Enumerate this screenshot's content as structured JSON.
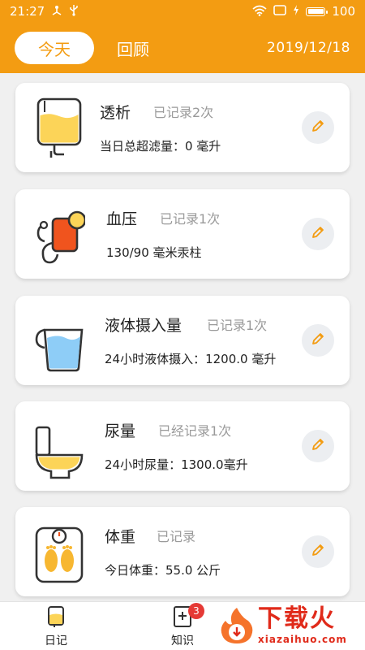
{
  "status_bar": {
    "time": "21:27",
    "battery": "100",
    "icons": [
      "usb-share-icon",
      "usb-icon",
      "wifi-icon",
      "sim-icon",
      "charging-icon",
      "battery-icon"
    ]
  },
  "header": {
    "tabs": [
      {
        "label": "今天",
        "active": true
      },
      {
        "label": "回顾",
        "active": false
      }
    ],
    "date": "2019/12/18"
  },
  "cards": [
    {
      "title": "透析",
      "count": "已记录2次",
      "value": "当日总超滤量：0 毫升",
      "icon": "dialysis-bag-icon"
    },
    {
      "title": "血压",
      "count": "已记录1次",
      "value": "130/90 毫米汞柱",
      "icon": "blood-pressure-icon"
    },
    {
      "title": "液体摄入量",
      "count": "已记录1次",
      "value": "24小时液体摄入：1200.0 毫升",
      "icon": "water-cup-icon"
    },
    {
      "title": "尿量",
      "count": "已经记录1次",
      "value": "24小时尿量：1300.0毫升",
      "icon": "toilet-icon"
    },
    {
      "title": "体重",
      "count": "已记录",
      "value": "今日体重：55.0 公斤",
      "icon": "scale-icon"
    }
  ],
  "bottom_nav": {
    "items": [
      {
        "label": "日记",
        "icon": "diary-icon"
      },
      {
        "label": "知识",
        "icon": "knowledge-icon",
        "badge": "3"
      }
    ]
  },
  "watermark": {
    "brand": "下载火",
    "url": "xiazaihuo.com"
  },
  "colors": {
    "accent": "#f39c12",
    "background": "#f0f0f0",
    "badge": "#e53935"
  }
}
